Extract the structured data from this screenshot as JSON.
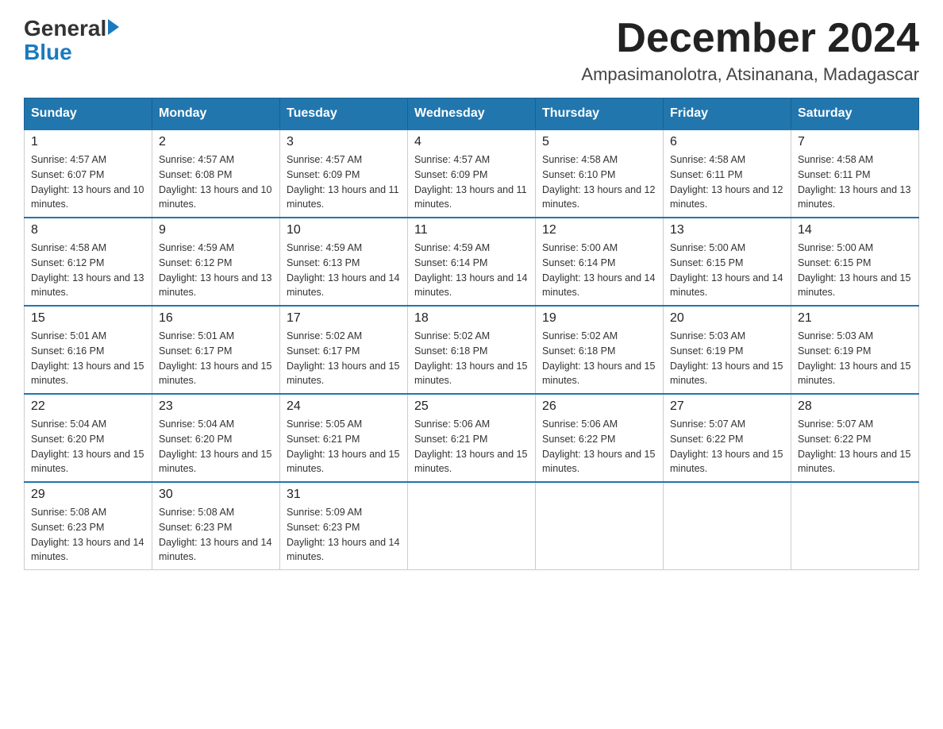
{
  "header": {
    "logo_general": "General",
    "logo_blue": "Blue",
    "month_title": "December 2024",
    "location": "Ampasimanolotra, Atsinanana, Madagascar"
  },
  "days_of_week": [
    "Sunday",
    "Monday",
    "Tuesday",
    "Wednesday",
    "Thursday",
    "Friday",
    "Saturday"
  ],
  "weeks": [
    [
      {
        "day": "1",
        "sunrise": "4:57 AM",
        "sunset": "6:07 PM",
        "daylight": "13 hours and 10 minutes."
      },
      {
        "day": "2",
        "sunrise": "4:57 AM",
        "sunset": "6:08 PM",
        "daylight": "13 hours and 10 minutes."
      },
      {
        "day": "3",
        "sunrise": "4:57 AM",
        "sunset": "6:09 PM",
        "daylight": "13 hours and 11 minutes."
      },
      {
        "day": "4",
        "sunrise": "4:57 AM",
        "sunset": "6:09 PM",
        "daylight": "13 hours and 11 minutes."
      },
      {
        "day": "5",
        "sunrise": "4:58 AM",
        "sunset": "6:10 PM",
        "daylight": "13 hours and 12 minutes."
      },
      {
        "day": "6",
        "sunrise": "4:58 AM",
        "sunset": "6:11 PM",
        "daylight": "13 hours and 12 minutes."
      },
      {
        "day": "7",
        "sunrise": "4:58 AM",
        "sunset": "6:11 PM",
        "daylight": "13 hours and 13 minutes."
      }
    ],
    [
      {
        "day": "8",
        "sunrise": "4:58 AM",
        "sunset": "6:12 PM",
        "daylight": "13 hours and 13 minutes."
      },
      {
        "day": "9",
        "sunrise": "4:59 AM",
        "sunset": "6:12 PM",
        "daylight": "13 hours and 13 minutes."
      },
      {
        "day": "10",
        "sunrise": "4:59 AM",
        "sunset": "6:13 PM",
        "daylight": "13 hours and 14 minutes."
      },
      {
        "day": "11",
        "sunrise": "4:59 AM",
        "sunset": "6:14 PM",
        "daylight": "13 hours and 14 minutes."
      },
      {
        "day": "12",
        "sunrise": "5:00 AM",
        "sunset": "6:14 PM",
        "daylight": "13 hours and 14 minutes."
      },
      {
        "day": "13",
        "sunrise": "5:00 AM",
        "sunset": "6:15 PM",
        "daylight": "13 hours and 14 minutes."
      },
      {
        "day": "14",
        "sunrise": "5:00 AM",
        "sunset": "6:15 PM",
        "daylight": "13 hours and 15 minutes."
      }
    ],
    [
      {
        "day": "15",
        "sunrise": "5:01 AM",
        "sunset": "6:16 PM",
        "daylight": "13 hours and 15 minutes."
      },
      {
        "day": "16",
        "sunrise": "5:01 AM",
        "sunset": "6:17 PM",
        "daylight": "13 hours and 15 minutes."
      },
      {
        "day": "17",
        "sunrise": "5:02 AM",
        "sunset": "6:17 PM",
        "daylight": "13 hours and 15 minutes."
      },
      {
        "day": "18",
        "sunrise": "5:02 AM",
        "sunset": "6:18 PM",
        "daylight": "13 hours and 15 minutes."
      },
      {
        "day": "19",
        "sunrise": "5:02 AM",
        "sunset": "6:18 PM",
        "daylight": "13 hours and 15 minutes."
      },
      {
        "day": "20",
        "sunrise": "5:03 AM",
        "sunset": "6:19 PM",
        "daylight": "13 hours and 15 minutes."
      },
      {
        "day": "21",
        "sunrise": "5:03 AM",
        "sunset": "6:19 PM",
        "daylight": "13 hours and 15 minutes."
      }
    ],
    [
      {
        "day": "22",
        "sunrise": "5:04 AM",
        "sunset": "6:20 PM",
        "daylight": "13 hours and 15 minutes."
      },
      {
        "day": "23",
        "sunrise": "5:04 AM",
        "sunset": "6:20 PM",
        "daylight": "13 hours and 15 minutes."
      },
      {
        "day": "24",
        "sunrise": "5:05 AM",
        "sunset": "6:21 PM",
        "daylight": "13 hours and 15 minutes."
      },
      {
        "day": "25",
        "sunrise": "5:06 AM",
        "sunset": "6:21 PM",
        "daylight": "13 hours and 15 minutes."
      },
      {
        "day": "26",
        "sunrise": "5:06 AM",
        "sunset": "6:22 PM",
        "daylight": "13 hours and 15 minutes."
      },
      {
        "day": "27",
        "sunrise": "5:07 AM",
        "sunset": "6:22 PM",
        "daylight": "13 hours and 15 minutes."
      },
      {
        "day": "28",
        "sunrise": "5:07 AM",
        "sunset": "6:22 PM",
        "daylight": "13 hours and 15 minutes."
      }
    ],
    [
      {
        "day": "29",
        "sunrise": "5:08 AM",
        "sunset": "6:23 PM",
        "daylight": "13 hours and 14 minutes."
      },
      {
        "day": "30",
        "sunrise": "5:08 AM",
        "sunset": "6:23 PM",
        "daylight": "13 hours and 14 minutes."
      },
      {
        "day": "31",
        "sunrise": "5:09 AM",
        "sunset": "6:23 PM",
        "daylight": "13 hours and 14 minutes."
      },
      null,
      null,
      null,
      null
    ]
  ]
}
